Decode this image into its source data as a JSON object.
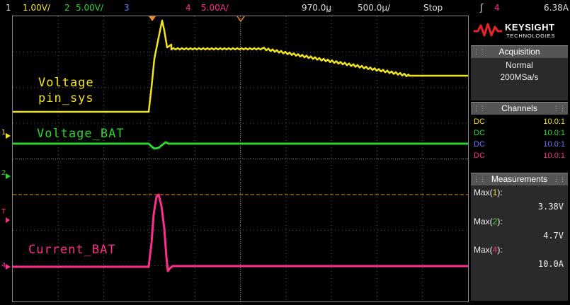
{
  "topbar": {
    "ch1_num": "1",
    "ch1_scale": "1.00V/",
    "ch2_num": "2",
    "ch2_scale": "5.00V/",
    "ch3_num": "3",
    "ch4_num": "4",
    "ch4_scale": "5.00A/",
    "time_offset": "970.0µ̱",
    "time_scale": "500.0µ/",
    "run_state": "Stop",
    "trigger_icon": "ʃ",
    "trigger_ch": "4",
    "trigger_level": "6.38A"
  },
  "colors": {
    "ch1": "#f2e41c",
    "ch2": "#2cd630",
    "ch3": "#6b78ff",
    "ch4": "#ff2e8c",
    "trigger_marker": "#f08a1a",
    "grid": "#5a5a5a"
  },
  "overlays": {
    "voltage_sys_line1": "Voltage",
    "voltage_sys_line2": "pin_sys",
    "voltage_bat": "Voltage_BAT",
    "current_bat": "Current_BAT"
  },
  "left_markers": {
    "ch1": "1",
    "ch2": "2",
    "trig": "T",
    "ch4": "4"
  },
  "brand": {
    "name": "KEYSIGHT",
    "sub": "TECHNOLOGIES"
  },
  "acquisition": {
    "title": "Acquisition",
    "mode": "Normal",
    "rate": "200MSa/s"
  },
  "channels": {
    "title": "Channels",
    "rows": [
      {
        "coupling": "DC",
        "ratio": "10.0:1"
      },
      {
        "coupling": "DC",
        "ratio": "10.0:1"
      },
      {
        "coupling": "DC",
        "ratio": "10.0:1"
      },
      {
        "coupling": "DC",
        "ratio": "10.0:1"
      }
    ]
  },
  "measurements": {
    "title": "Measurements",
    "items": [
      {
        "label_pre": "Max(",
        "ch": "1",
        "label_post": "):",
        "value": "3.38V"
      },
      {
        "label_pre": "Max(",
        "ch": "2",
        "label_post": "):",
        "value": "4.7V"
      },
      {
        "label_pre": "Max(",
        "ch": "4",
        "label_post": "):",
        "value": "10.0A"
      }
    ]
  }
}
